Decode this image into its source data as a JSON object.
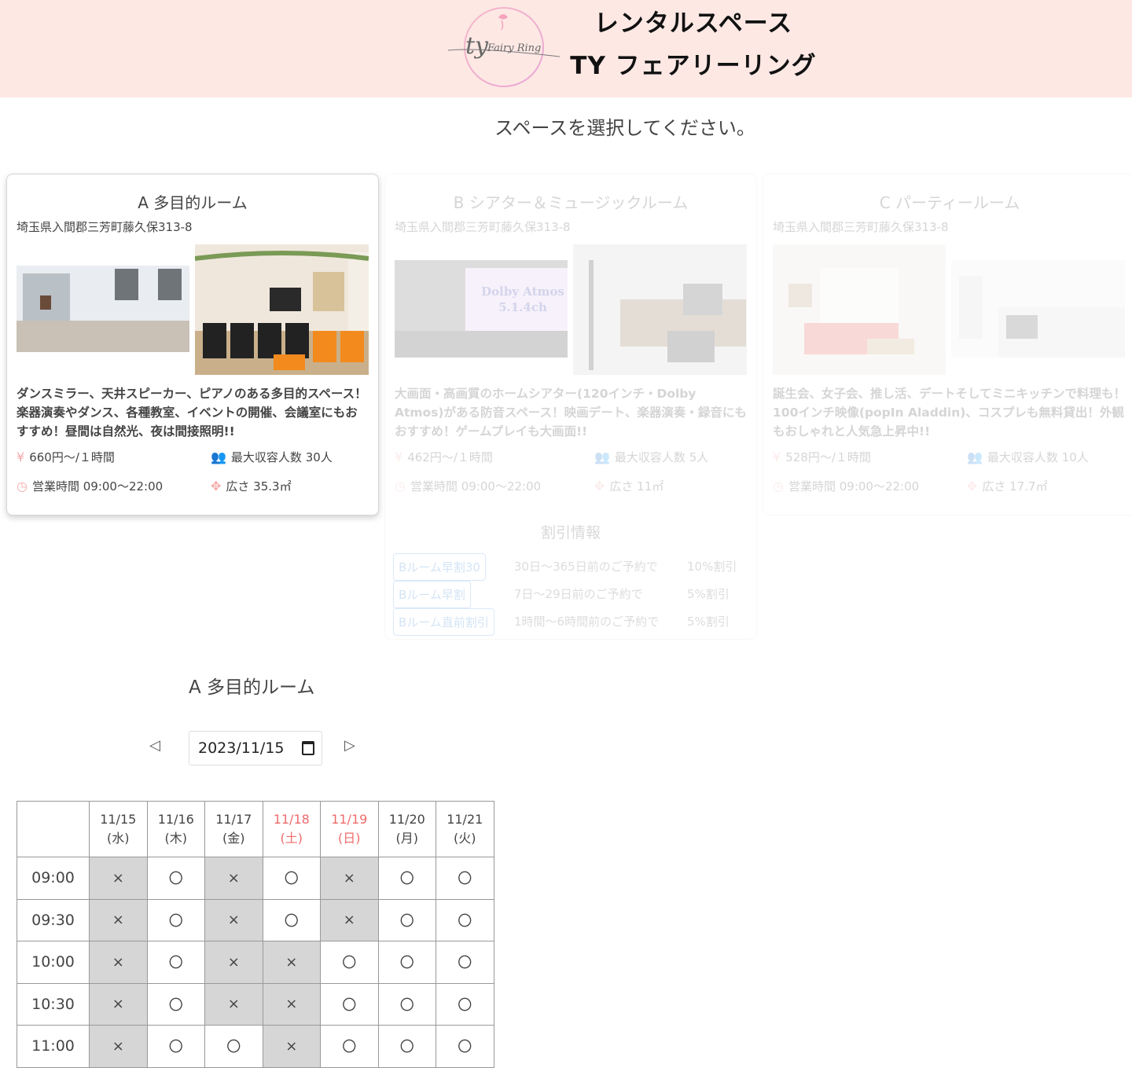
{
  "header": {
    "brand_line1": "レンタルスペース",
    "brand_line2": "TY フェアリーリング",
    "logo_text": "Fairy Ring"
  },
  "select_prompt": "スペースを選択してください。",
  "rooms": [
    {
      "title": "A 多目的ルーム",
      "address": "埼玉県入間郡三芳町藤久保313-8",
      "description": "ダンスミラー、天井スピーカー、ピアノのある多目的スペース！楽器演奏やダンス、各種教室、イベントの開催、会議室にもおすすめ！昼間は自然光、夜は間接照明!!",
      "price": "660円～/１時間",
      "capacity": "最大収容人数 30人",
      "hours": "営業時間 09:00～22:00",
      "area": "広さ 35.3㎡",
      "state": "selected"
    },
    {
      "title": "B シアター＆ミュージックルーム",
      "address": "埼玉県入間郡三芳町藤久保313-8",
      "description": "大画面・高画質のホームシアター(120インチ・Dolby Atmos)がある防音スペース！映画デート、楽器演奏・録音にもおすすめ！ゲームプレイも大画面!!",
      "price": "462円～/１時間",
      "capacity": "最大収容人数 5人",
      "hours": "営業時間 09:00～22:00",
      "area": "広さ 11㎡",
      "photo_text": "Dolby Atmos 5.1.4ch",
      "discount_title": "割引情報",
      "discounts": [
        {
          "name": "Bルーム早割30",
          "condition": "30日～365日前のご予約で",
          "rate": "10%割引"
        },
        {
          "name": "Bルーム早割",
          "condition": "7日～29日前のご予約で",
          "rate": "5%割引"
        },
        {
          "name": "Bルーム直前割引",
          "condition": "1時間～6時間前のご予約で",
          "rate": "5%割引"
        }
      ],
      "state": "dimmed"
    },
    {
      "title": "C パーティールーム",
      "address": "埼玉県入間郡三芳町藤久保313-8",
      "description": "誕生会、女子会、推し活、デートそしてミニキッチンで料理も！100インチ映像(popIn Aladdin)、コスプレも無料貸出！外観もおしゃれと人気急上昇中!!",
      "price": "528円～/１時間",
      "capacity": "最大収容人数 10人",
      "hours": "営業時間 09:00～22:00",
      "area": "広さ 17.7㎡",
      "state": "dimmed"
    }
  ],
  "schedule": {
    "room_title": "A 多目的ルーム",
    "date_value": "2023/11/15",
    "prev_label": "◁",
    "next_label": "▷",
    "days": [
      {
        "date": "11/15",
        "dow": "(水)",
        "weekend": false
      },
      {
        "date": "11/16",
        "dow": "(木)",
        "weekend": false
      },
      {
        "date": "11/17",
        "dow": "(金)",
        "weekend": false
      },
      {
        "date": "11/18",
        "dow": "(土)",
        "weekend": true
      },
      {
        "date": "11/19",
        "dow": "(日)",
        "weekend": true
      },
      {
        "date": "11/20",
        "dow": "(月)",
        "weekend": false
      },
      {
        "date": "11/21",
        "dow": "(火)",
        "weekend": false
      }
    ],
    "rows": [
      {
        "time": "09:00",
        "slots": [
          "×",
          "〇",
          "×",
          "〇",
          "×",
          "〇",
          "〇"
        ]
      },
      {
        "time": "09:30",
        "slots": [
          "×",
          "〇",
          "×",
          "〇",
          "×",
          "〇",
          "〇"
        ]
      },
      {
        "time": "10:00",
        "slots": [
          "×",
          "〇",
          "×",
          "×",
          "〇",
          "〇",
          "〇"
        ]
      },
      {
        "time": "10:30",
        "slots": [
          "×",
          "〇",
          "×",
          "×",
          "〇",
          "〇",
          "〇"
        ]
      },
      {
        "time": "11:00",
        "slots": [
          "×",
          "〇",
          "〇",
          "×",
          "〇",
          "〇",
          "〇"
        ]
      }
    ]
  },
  "colors": {
    "header_bg": "#fde8e4",
    "weekend_text": "#ef6b6b",
    "unavailable_bg": "#d6d6d6",
    "icon_pink": "#f4a9a9",
    "discount_blue": "#3b86d6"
  }
}
